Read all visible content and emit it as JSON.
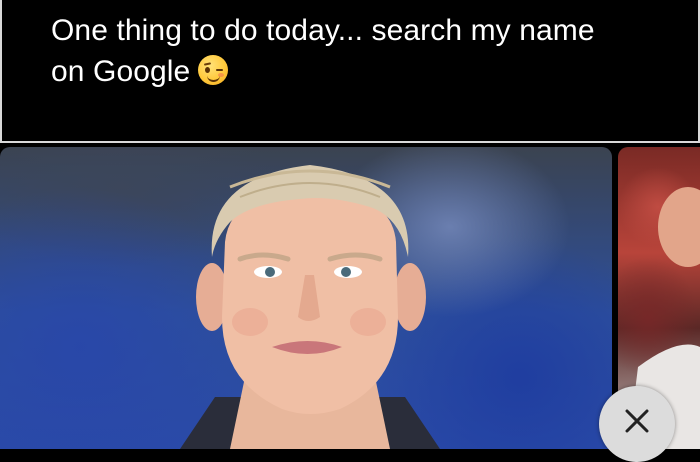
{
  "caption": {
    "line1": "One thing to do today... search my name",
    "line2": "on Google",
    "emoji": "winking-face"
  },
  "images": [
    {
      "name": "main-photo",
      "description_icon": "portrait-photo"
    },
    {
      "name": "side-photo",
      "description_icon": "partial-photo"
    }
  ],
  "controls": {
    "close_icon": "close-icon"
  },
  "colors": {
    "background": "#000000",
    "caption_text": "#ffffff",
    "close_button_bg": "#dcdcdc"
  }
}
